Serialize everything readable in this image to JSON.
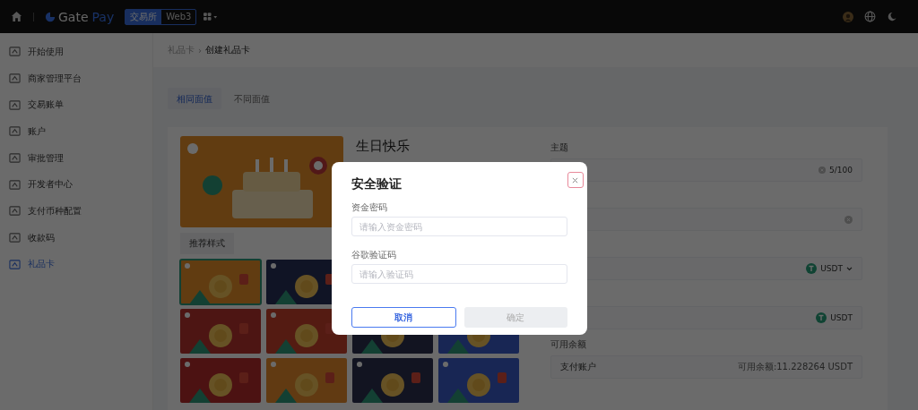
{
  "top_bar": {
    "brand": {
      "name": "Gate",
      "product": "Pay"
    },
    "switch": [
      {
        "label": "交易所",
        "selected": true
      },
      {
        "label": "Web3",
        "selected": false
      }
    ]
  },
  "sidebar": {
    "items": [
      {
        "label": "开始使用",
        "selected": false
      },
      {
        "label": "商家管理平台",
        "selected": false
      },
      {
        "label": "交易账单",
        "selected": false
      },
      {
        "label": "账户",
        "selected": false
      },
      {
        "label": "审批管理",
        "selected": false
      },
      {
        "label": "开发者中心",
        "selected": false
      },
      {
        "label": "支付币种配置",
        "selected": false
      },
      {
        "label": "收款码",
        "selected": false
      },
      {
        "label": "礼品卡",
        "selected": true
      }
    ]
  },
  "breadcrumb": {
    "parent": "礼品卡",
    "separator": "›",
    "current": "创建礼品卡"
  },
  "tabs": [
    {
      "label": "相同面值",
      "selected": true
    },
    {
      "label": "不同面值",
      "selected": false
    }
  ],
  "card_preview": {
    "title": "生日快乐"
  },
  "styles": {
    "button": "推荐样式",
    "thumbnails": [
      {
        "kind": "picture",
        "selected": true
      },
      {
        "kind": "picture",
        "selected": false
      },
      {
        "kind": "covered"
      },
      {
        "kind": "covered"
      },
      {
        "kind": "picture",
        "selected": false
      },
      {
        "kind": "picture",
        "selected": false
      },
      {
        "kind": "picture",
        "selected": false
      },
      {
        "kind": "picture",
        "selected": false
      },
      {
        "kind": "picture",
        "selected": false
      },
      {
        "kind": "picture",
        "selected": false
      },
      {
        "kind": "picture",
        "selected": false
      },
      {
        "kind": "picture",
        "selected": false
      }
    ]
  },
  "form": {
    "fields": [
      {
        "kind": "counter",
        "label": "主题",
        "suffix": "5/100"
      },
      {
        "kind": "clear"
      },
      {
        "kind": "select",
        "value": "USDT"
      },
      {
        "kind": "coin",
        "value": "USDT"
      },
      {
        "kind": "balance",
        "label": "可用余额",
        "value": "支付账户",
        "note": "可用余额:11.228264 USDT"
      }
    ]
  },
  "dialog": {
    "title": "安全验证",
    "fields": [
      {
        "label": "资金密码",
        "placeholder": "请输入资金密码"
      },
      {
        "label": "谷歌验证码",
        "placeholder": "请输入验证码"
      }
    ],
    "buttons": [
      {
        "label": "取消",
        "disabled": false
      },
      {
        "label": "确定",
        "disabled": true
      }
    ]
  }
}
